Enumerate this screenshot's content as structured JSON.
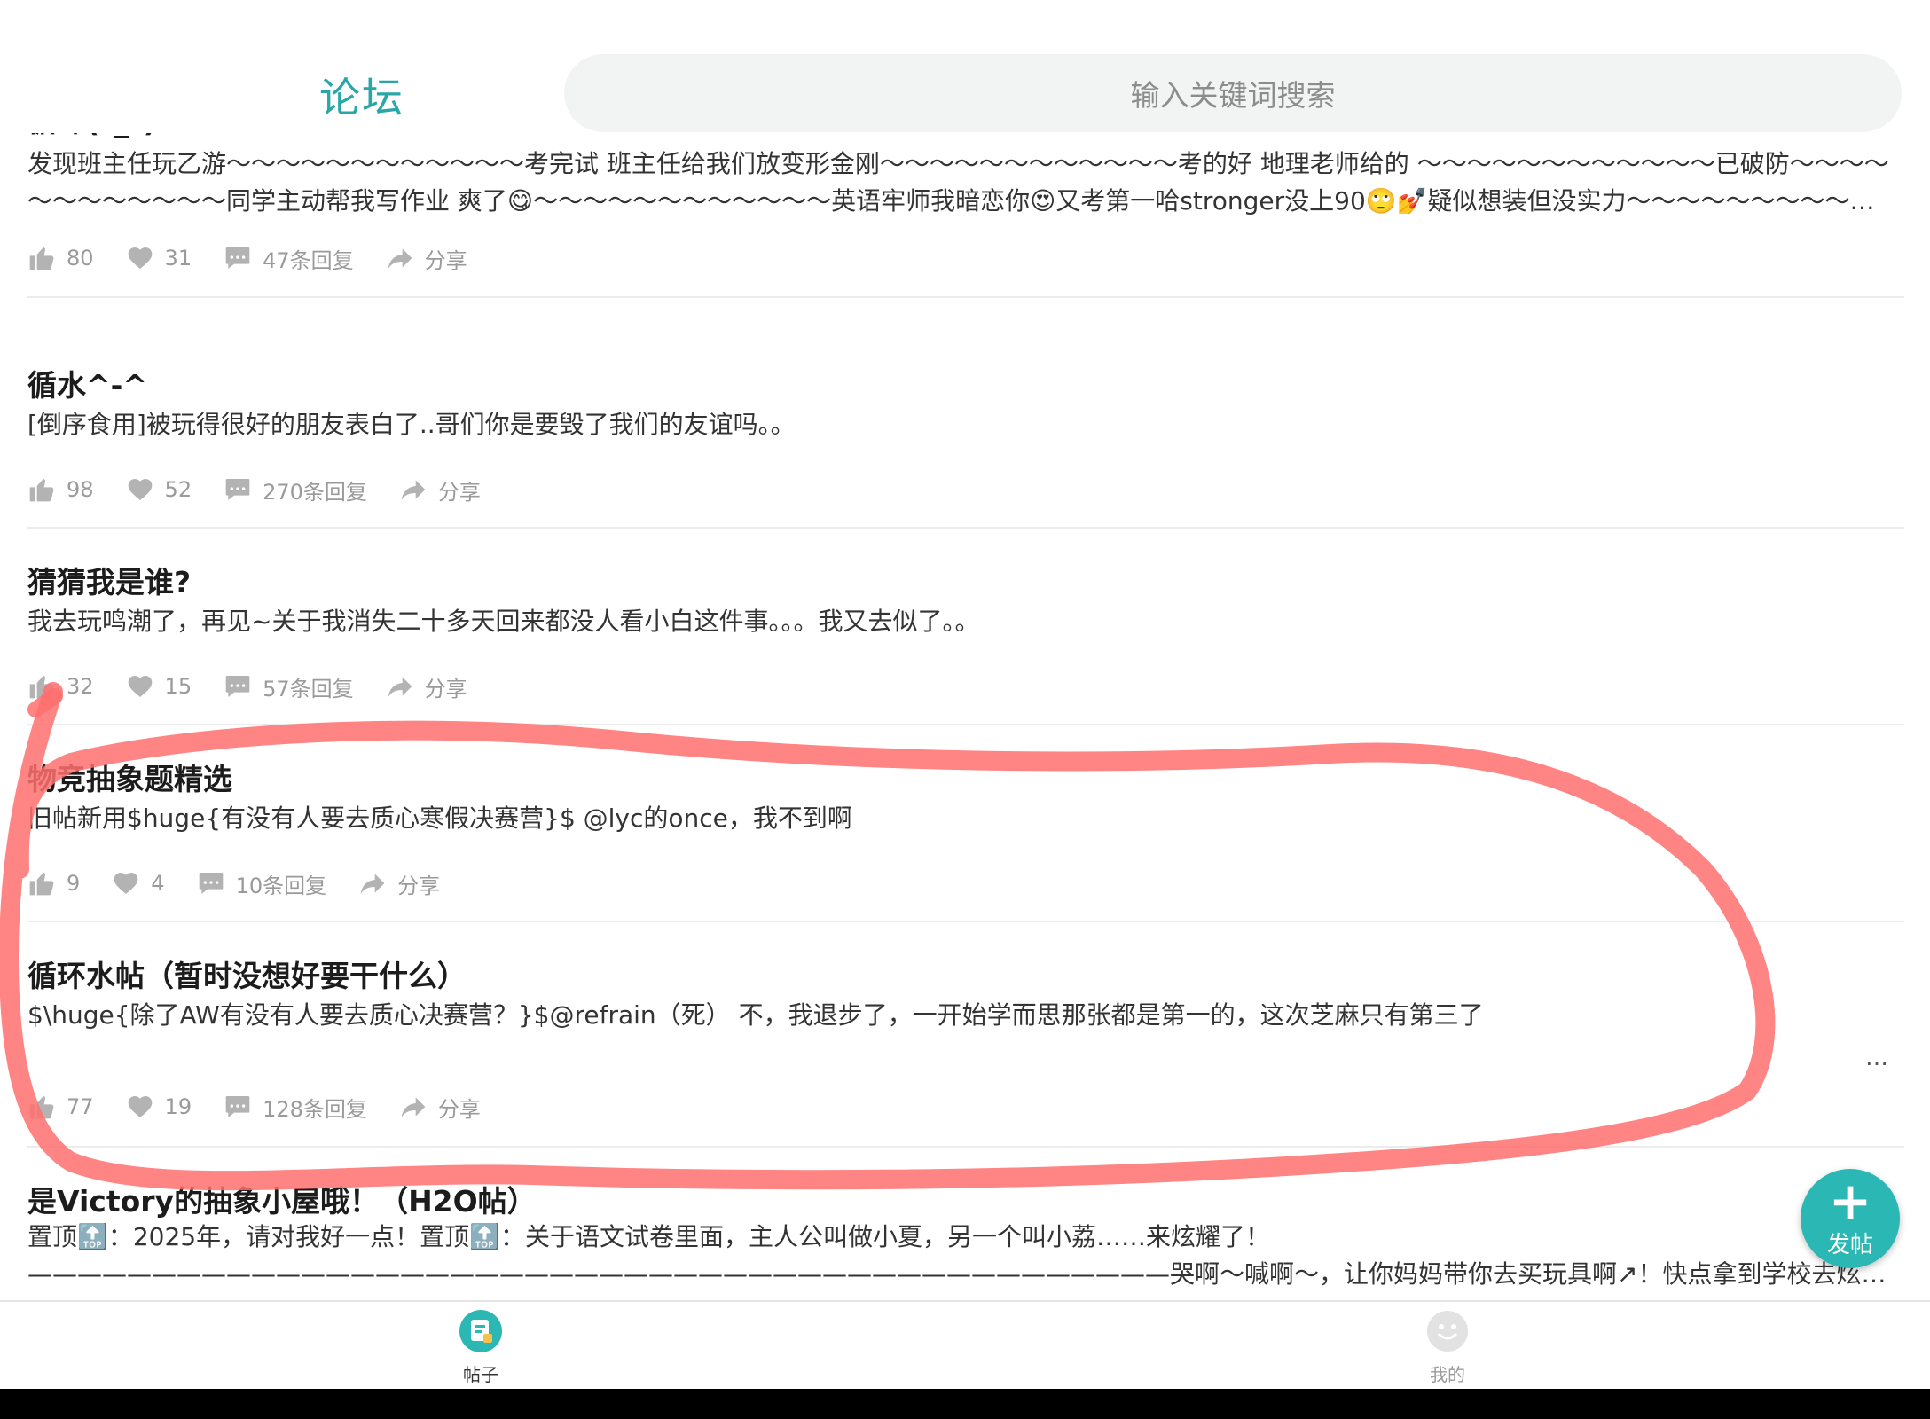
{
  "header": {
    "title": "论坛",
    "search_placeholder": "输入关键词搜索"
  },
  "posts": [
    {
      "title": "循环(ˆ_ˆ)",
      "body": "发现班主任玩乙游～～～～～～～～～～～～考完试 班主任给我们放变形金刚～～～～～～～～～～～～考的好 地理老师给的 ～～～～～～～～～～～～已破防～～～～～～～～～～～～同学主动帮我写作业 爽了😋～～～～～～～～～～～～英语牢师我暗恋你😍又考第一哈stronger没上90🙄💅疑似想装但没实力～～～～～～～～～～～～陪…",
      "likes": "80",
      "favorites": "31",
      "replies": "47条回复",
      "share": "分享"
    },
    {
      "title": "循水^-^",
      "body": "[倒序食用]被玩得很好的朋友表白了..哥们你是要毁了我们的友谊吗。。",
      "likes": "98",
      "favorites": "52",
      "replies": "270条回复",
      "share": "分享"
    },
    {
      "title": "猜猜我是谁?",
      "body": "我去玩鸣潮了，再见~关于我消失二十多天回来都没人看小白这件事。。。我又去似了。。",
      "likes": "32",
      "favorites": "15",
      "replies": "57条回复",
      "share": "分享"
    },
    {
      "title": "物竞抽象题精选",
      "body": "旧帖新用$huge{有没有人要去质心寒假决赛营}$  @lyc的once，我不到啊",
      "likes": "9",
      "favorites": "4",
      "replies": "10条回复",
      "share": "分享"
    },
    {
      "title": "循环水帖（暂时没想好要干什么）",
      "body": "$\\huge{除了AW有没有人要去质心决赛营？}$@refrain（死） 不，我退步了，一开始学而思那张都是第一的，这次芝麻只有第三了",
      "more": "…",
      "likes": "77",
      "favorites": "19",
      "replies": "128条回复",
      "share": "分享"
    },
    {
      "title": "是Victory的抽象小屋哦！（H2O帖）",
      "body": "置顶🔝：2025年，请对我好一点！置顶🔝：关于语文试卷里面，主人公叫做小夏，另一个叫小荔……来炫耀了！——————————————————————————————————————————————哭啊～喊啊～，让你妈妈带你去买玩具啊↗！快点拿到学校去炫耀吧↗！孩子交点朋友吧↘…"
    }
  ],
  "fab": {
    "label": "发帖"
  },
  "tabs": [
    {
      "label": "帖子",
      "active": true
    },
    {
      "label": "我的",
      "active": false
    }
  ],
  "colors": {
    "accent": "#2aa6a6",
    "fab": "#2bb7b3",
    "annotation": "#ff6e6e"
  }
}
